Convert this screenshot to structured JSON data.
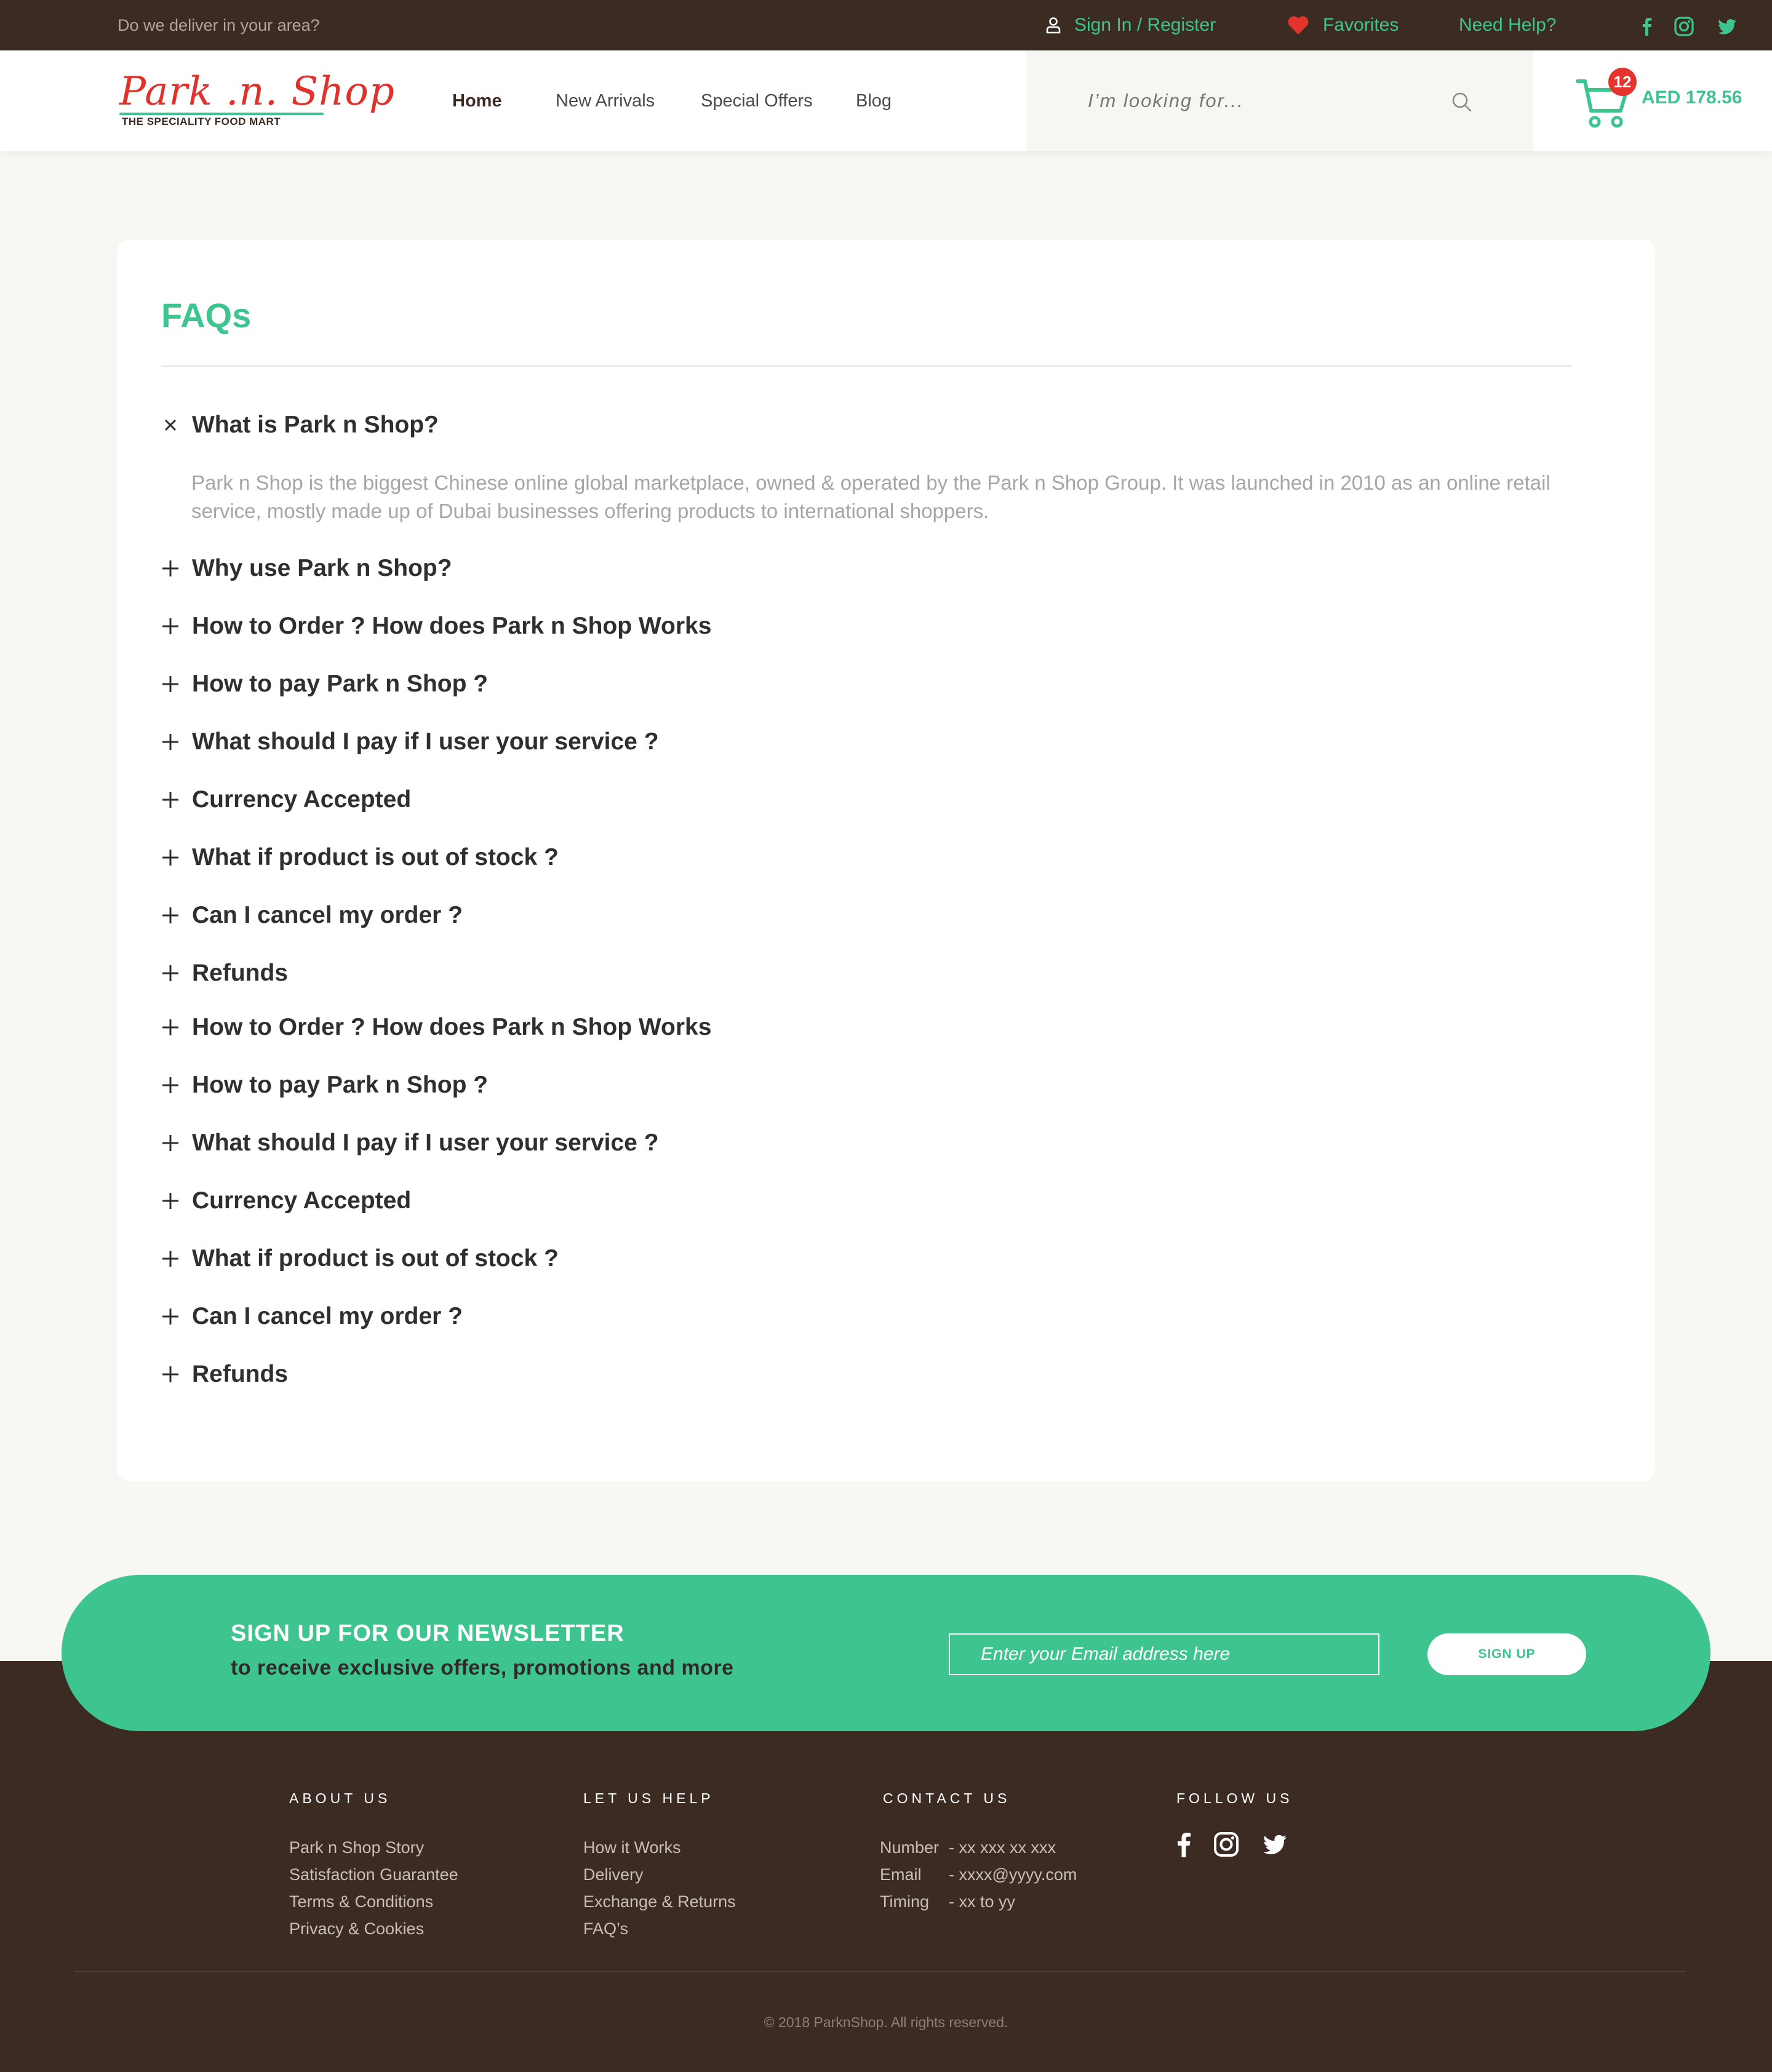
{
  "topbar": {
    "deliver_text": "Do we deliver in your area?",
    "signin_label": "Sign In / Register",
    "favorites_label": "Favorites",
    "help_label": "Need Help?",
    "social": [
      "facebook-icon",
      "instagram-icon",
      "twitter-icon"
    ]
  },
  "header": {
    "logo_text": "Park .n. Shop",
    "logo_tagline": "THE SPECIALITY FOOD MART",
    "nav": [
      {
        "label": "Home",
        "active": true
      },
      {
        "label": "New Arrivals",
        "active": false
      },
      {
        "label": "Special Offers",
        "active": false
      },
      {
        "label": "Blog",
        "active": false
      }
    ],
    "search_placeholder": "I’m looking for...",
    "cart_count": "12",
    "cart_total": "AED 178.56"
  },
  "faq": {
    "title": "FAQs",
    "items": [
      {
        "question": "What is Park n Shop?",
        "expanded": true,
        "answer": "Park n Shop is the biggest Chinese online global marketplace, owned & operated by the Park n Shop Group. It was launched in 2010 as an online retail service, mostly made up of Dubai businesses offering products to international shoppers."
      },
      {
        "question": "Why use Park n Shop?",
        "expanded": false
      },
      {
        "question": "How to Order ? How does Park n Shop Works",
        "expanded": false
      },
      {
        "question": "How to pay Park n Shop ?",
        "expanded": false
      },
      {
        "question": "What should I pay if I user your service ?",
        "expanded": false
      },
      {
        "question": "Currency Accepted",
        "expanded": false
      },
      {
        "question": "What if product is out of stock ?",
        "expanded": false
      },
      {
        "question": "Can I cancel my order ?",
        "expanded": false
      },
      {
        "question": "Refunds",
        "expanded": false
      },
      {
        "question": "How to Order ? How does Park n Shop Works",
        "expanded": false
      },
      {
        "question": "How to pay Park n Shop ?",
        "expanded": false
      },
      {
        "question": "What should I pay if I user your service ?",
        "expanded": false
      },
      {
        "question": "Currency Accepted",
        "expanded": false
      },
      {
        "question": "What if product is out of stock ?",
        "expanded": false
      },
      {
        "question": "Can I cancel my order ?",
        "expanded": false
      },
      {
        "question": "Refunds",
        "expanded": false
      }
    ]
  },
  "newsletter": {
    "title": "SIGN UP FOR OUR NEWSLETTER",
    "subtitle": "to receive exclusive offers, promotions and more",
    "input_placeholder": "Enter your Email address here",
    "button_label": "SIGN UP"
  },
  "footer": {
    "about": {
      "heading": "ABOUT US",
      "links": [
        "Park n Shop Story",
        "Satisfaction Guarantee",
        "Terms & Conditions",
        "Privacy & Cookies"
      ]
    },
    "help": {
      "heading": "LET US HELP",
      "links": [
        "How it Works",
        "Delivery",
        "Exchange & Returns",
        "FAQ’s"
      ]
    },
    "contact": {
      "heading": "CONTACT US",
      "rows": [
        {
          "key": "Number",
          "value": "- xx xxx xx xxx"
        },
        {
          "key": "Email",
          "value": "- xxxx@yyyy.com"
        },
        {
          "key": "Timing",
          "value": "- xx to yy"
        }
      ]
    },
    "follow": {
      "heading": "FOLLOW US",
      "icons": [
        "facebook-icon",
        "instagram-icon",
        "twitter-icon"
      ]
    },
    "copyright": "© 2018 ParknShop. All rights reserved."
  },
  "colors": {
    "brand_green": "#3ec48f",
    "dark_brown": "#3b2b23",
    "logo_red": "#e2302b",
    "badge_red": "#e3342d"
  }
}
